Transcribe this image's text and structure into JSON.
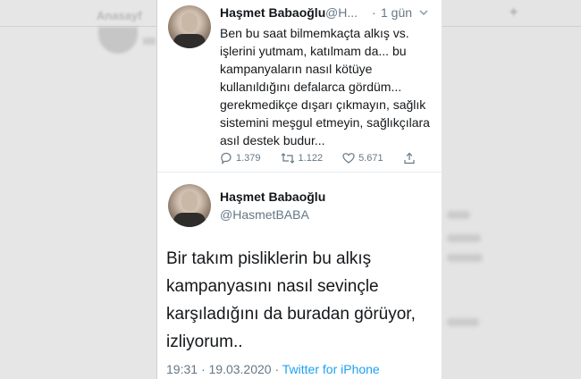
{
  "background": {
    "left_title": "Anasayf",
    "colors": {
      "page": "#d8d8d8",
      "card": "#ffffff",
      "link": "#1da1f2",
      "muted": "#657786"
    }
  },
  "tweet1": {
    "name": "Haşmet Babaoğlu",
    "handle": "@H...",
    "separator": "·",
    "time": "1 gün",
    "text": "Ben bu saat bilmemkaçta alkış vs. işlerini yutmam, katılmam da... bu kampanyaların nasıl kötüye kullanıldığını defalarca gördüm... gerekmedikçe dışarı çıkmayın, sağlık sistemini meşgul etmeyin, sağlıkçılara asıl destek budur...",
    "replies": "1.379",
    "retweets": "1.122",
    "likes": "5.671",
    "icons": [
      "reply-icon",
      "retweet-icon",
      "like-icon",
      "share-icon",
      "chevron-down-icon"
    ]
  },
  "tweet2": {
    "name": "Haşmet Babaoğlu",
    "handle": "@HasmetBABA",
    "text": "Bir takım pisliklerin bu alkış kampanyasını nasıl sevinçle karşıladığını da buradan görüyor, izliyorum..",
    "time": "19:31",
    "date": "19.03.2020",
    "separator": "·",
    "source": "Twitter for iPhone"
  }
}
